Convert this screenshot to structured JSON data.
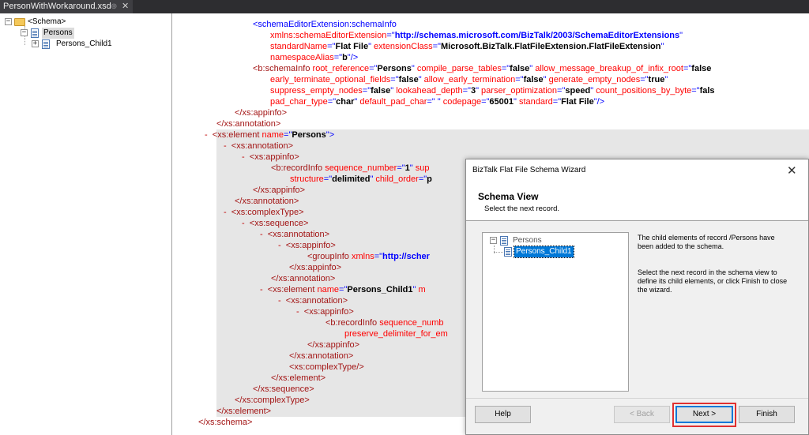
{
  "tab": {
    "title": "PersonWithWorkaround.xsd",
    "pin": "⊕",
    "close": "✕"
  },
  "tree": {
    "root_label": "<Schema>",
    "root_expander": "−",
    "persons_label": "Persons",
    "persons_expander": "−",
    "child_label": "Persons_Child1",
    "child_expander": "+"
  },
  "code": {
    "l1": {
      "tag": "<schemaEditorExtension:schemaInfo"
    },
    "l2": {
      "attr": "xmlns:schemaEditorExtension",
      "val": "http://schemas.microsoft.com/BizTalk/2003/SchemaEditorExtensions"
    },
    "l3": {
      "a1": "standardName",
      "v1": "Flat File",
      "a2": "extensionClass",
      "v2": "Microsoft.BizTalk.FlatFileExtension.FlatFileExtension"
    },
    "l4": {
      "a1": "namespaceAlias",
      "v1": "b",
      "end": "/>"
    },
    "l5": {
      "tag": "<b:schemaInfo",
      "a1": "root_reference",
      "v1": "Persons",
      "a2": "compile_parse_tables",
      "v2": "false",
      "a3": "allow_message_breakup_of_infix_root",
      "v3": "false"
    },
    "l6": {
      "a1": "early_terminate_optional_fields",
      "v1": "false",
      "a2": "allow_early_termination",
      "v2": "false",
      "a3": "generate_empty_nodes",
      "v3": "true"
    },
    "l7": {
      "a1": "suppress_empty_nodes",
      "v1": "false",
      "a2": "lookahead_depth",
      "v2": "3",
      "a3": "parser_optimization",
      "v3": "speed",
      "a4": "count_positions_by_byte",
      "v4": "fals"
    },
    "l8": {
      "a1": "pad_char_type",
      "v1": "char",
      "a2": "default_pad_char",
      "v2": " ",
      "a3": "codepage",
      "v3": "65001",
      "a4": "standard",
      "v4": "Flat File",
      "end": "/>"
    },
    "l9": {
      "tag": "</xs:appinfo>"
    },
    "l10": {
      "tag": "</xs:annotation>"
    },
    "l11": {
      "collapse": "-",
      "tag": "<xs:element",
      "a1": "name",
      "v1": "Persons",
      "end": ">"
    },
    "l12": {
      "collapse": "-",
      "tag": "<xs:annotation>"
    },
    "l13": {
      "collapse": "-",
      "tag": "<xs:appinfo>"
    },
    "l14": {
      "tag": "<b:recordInfo",
      "a1": "sequence_number",
      "v1": "1",
      "a2": "sup"
    },
    "l15": {
      "a1": "structure",
      "v1": "delimited",
      "a2": "child_order",
      "v2": "p"
    },
    "l16": {
      "tag": "</xs:appinfo>"
    },
    "l17": {
      "tag": "</xs:annotation>"
    },
    "l18": {
      "collapse": "-",
      "tag": "<xs:complexType>"
    },
    "l19": {
      "collapse": "-",
      "tag": "<xs:sequence>"
    },
    "l20": {
      "collapse": "-",
      "tag": "<xs:annotation>"
    },
    "l21": {
      "collapse": "-",
      "tag": "<xs:appinfo>"
    },
    "l22": {
      "tag": "<groupInfo",
      "a1": "xmlns",
      "v1": "http://scher"
    },
    "l23": {
      "tag": "</xs:appinfo>"
    },
    "l24": {
      "tag": "</xs:annotation>"
    },
    "l25": {
      "collapse": "-",
      "tag": "<xs:element",
      "a1": "name",
      "v1": "Persons_Child1",
      "a2": "m"
    },
    "l26": {
      "collapse": "-",
      "tag": "<xs:annotation>"
    },
    "l27": {
      "collapse": "-",
      "tag": "<xs:appinfo>"
    },
    "l28": {
      "tag": "<b:recordInfo",
      "a1": "sequence_numb"
    },
    "l29": {
      "a1": "preserve_delimiter_for_em"
    },
    "l30": {
      "tag": "</xs:appinfo>"
    },
    "l31": {
      "tag": "</xs:annotation>"
    },
    "l32": {
      "tag": "<xs:complexType/>"
    },
    "l33": {
      "tag": "</xs:element>"
    },
    "l34": {
      "tag": "</xs:sequence>"
    },
    "l35": {
      "tag": "</xs:complexType>"
    },
    "l36": {
      "tag": "</xs:element>"
    },
    "l37": {
      "tag": "</xs:schema>"
    }
  },
  "wizard": {
    "title": "BizTalk Flat File Schema Wizard",
    "close": "✕",
    "heading": "Schema View",
    "subheading": "Select the next record.",
    "tree_root": "Persons",
    "tree_root_expander": "−",
    "tree_child": "Persons_Child1",
    "desc1": "The child elements of record /Persons have been added to the schema.",
    "desc2": "Select the next record in the schema view to define its child elements, or click Finish to close the wizard.",
    "help": "Help",
    "back": "< Back",
    "next": "Next >",
    "finish": "Finish"
  }
}
